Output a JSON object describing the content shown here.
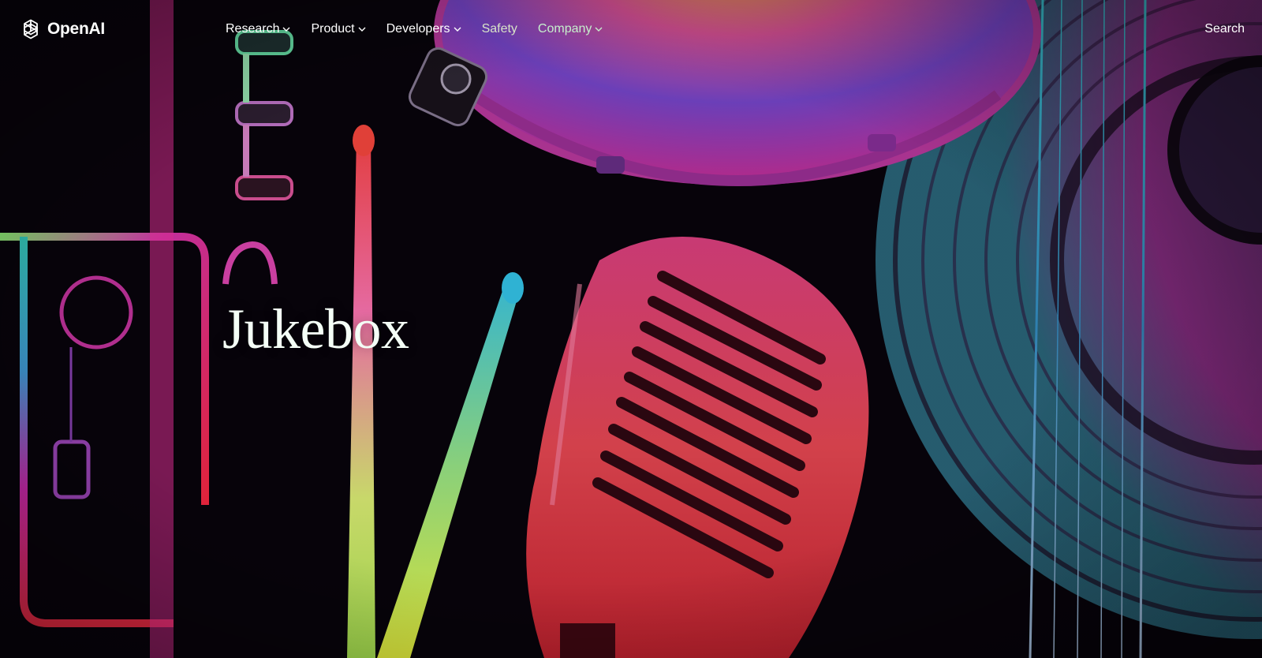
{
  "brand": {
    "name": "OpenAI",
    "logo_icon": "openai-knot-icon"
  },
  "nav": {
    "items": [
      {
        "label": "Research",
        "has_dropdown": true
      },
      {
        "label": "Product",
        "has_dropdown": true
      },
      {
        "label": "Developers",
        "has_dropdown": true
      },
      {
        "label": "Safety",
        "has_dropdown": false
      },
      {
        "label": "Company",
        "has_dropdown": true
      }
    ],
    "search_label": "Search",
    "dropdown_icon": "chevron-down-icon"
  },
  "hero": {
    "title": "Jukebox",
    "artwork": [
      "trumpet",
      "drumsticks",
      "snare-drum",
      "microphone",
      "vinyl-record",
      "guitar-neck"
    ]
  },
  "colors": {
    "background": "#07030a",
    "magenta": "#d0248c",
    "cyan": "#2aa9b8",
    "lime": "#b8e04a",
    "red": "#d1273a",
    "nav_green": "#c6efcd"
  }
}
